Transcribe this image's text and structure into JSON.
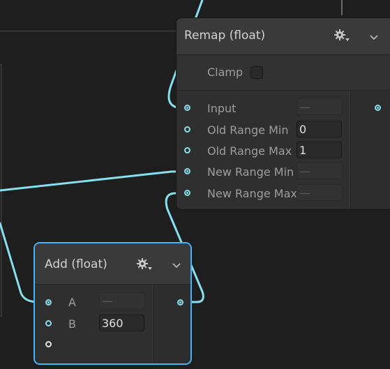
{
  "remap_node": {
    "title": "Remap (float)",
    "clamp_label": "Clamp",
    "inputs": [
      {
        "label": "Input",
        "value": "—",
        "connected": true
      },
      {
        "label": "Old Range Min",
        "value": "0",
        "connected": false
      },
      {
        "label": "Old Range Max",
        "value": "1",
        "connected": false
      },
      {
        "label": "New Range Min",
        "value": "—",
        "connected": true
      },
      {
        "label": "New Range Max",
        "value": "—",
        "connected": true
      }
    ],
    "output": {
      "connected": true
    }
  },
  "add_node": {
    "title": "Add (float)",
    "inputs": [
      {
        "label": "A",
        "value": "—",
        "connected": true
      },
      {
        "label": "B",
        "value": "360",
        "connected": false
      }
    ],
    "output": {
      "connected": true
    }
  },
  "colors": {
    "wire": "#86e0ee",
    "selection": "#44b4ff",
    "node_bg": "#393939",
    "canvas_bg": "#1e1e1e"
  },
  "icons": {
    "settings": "gear-dropdown-icon",
    "collapse": "chevron-down-icon"
  }
}
